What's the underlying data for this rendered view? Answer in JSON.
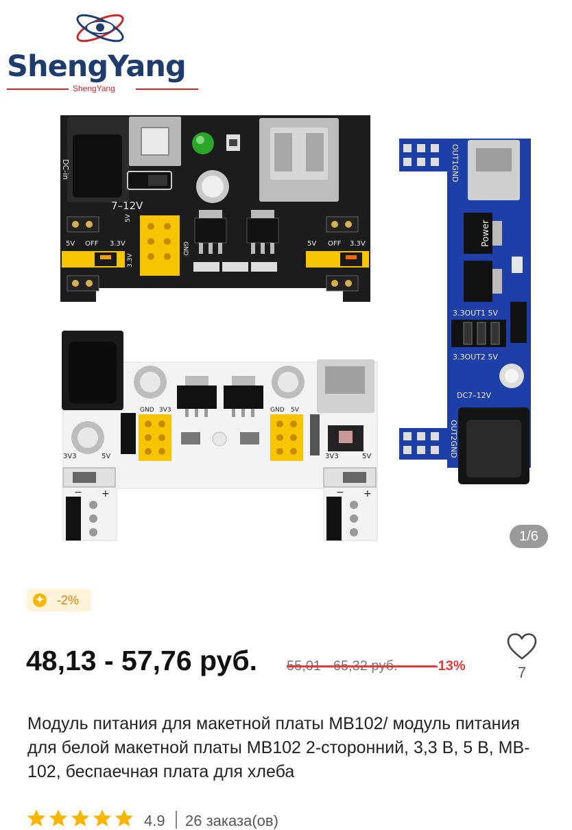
{
  "brand": {
    "name": "ShengYang",
    "sub": "ShengYang",
    "colors": {
      "blue": "#1f3c6e",
      "red": "#c8282a"
    }
  },
  "gallery": {
    "counter": "1/6",
    "boards": {
      "black": {
        "dc_label": "DC-in",
        "voltage": "7–12V",
        "left_jumper": {
          "v5": "5V",
          "off": "OFF",
          "v33": "3.3V"
        },
        "right_jumper": {
          "v5": "5V",
          "off": "OFF",
          "v33": "3.3V"
        },
        "pin_5v": "5V",
        "pin_gnd": "GND",
        "pin_33v": "3.3V"
      },
      "white": {
        "gnd_a": "GND",
        "v33_a": "3V3",
        "gnd_b": "GND",
        "v5_b": "5V",
        "sw_left_a": "3V3",
        "sw_left_b": "5V",
        "sw_right_a": "3V3",
        "sw_right_b": "5V",
        "minus": "−",
        "plus": "+"
      },
      "blue": {
        "out1": "OUT1GND",
        "power": "Power",
        "jumper1": "3.3OUT1 5V",
        "jumper2": "3.3OUT2 5V",
        "dc": "DC7–12V",
        "out2": "OUT2GND"
      }
    }
  },
  "discount": {
    "icon": "coin-icon",
    "label": "-2%",
    "colors": {
      "bg": "#fff4d9",
      "text": "#f07a00",
      "coin": "#f5b800"
    }
  },
  "price": {
    "current": "48,13 - 57,76 руб.",
    "old": "55,01 - 65,32 руб.",
    "percent": "-13%",
    "colors": {
      "sale": "#e53935"
    }
  },
  "wishlist": {
    "icon": "heart-icon",
    "count": "7"
  },
  "product_title": "Модуль питания для макетной платы MB102/ модуль питания для белой макетной платы MB102 2-сторонний, 3,3 В, 5 В, MB-102, беспаечная плата для хлеба",
  "rating": {
    "value": "4.9",
    "stars": 5,
    "orders": "26 заказа(ов)",
    "star_color": "#f5b800"
  }
}
